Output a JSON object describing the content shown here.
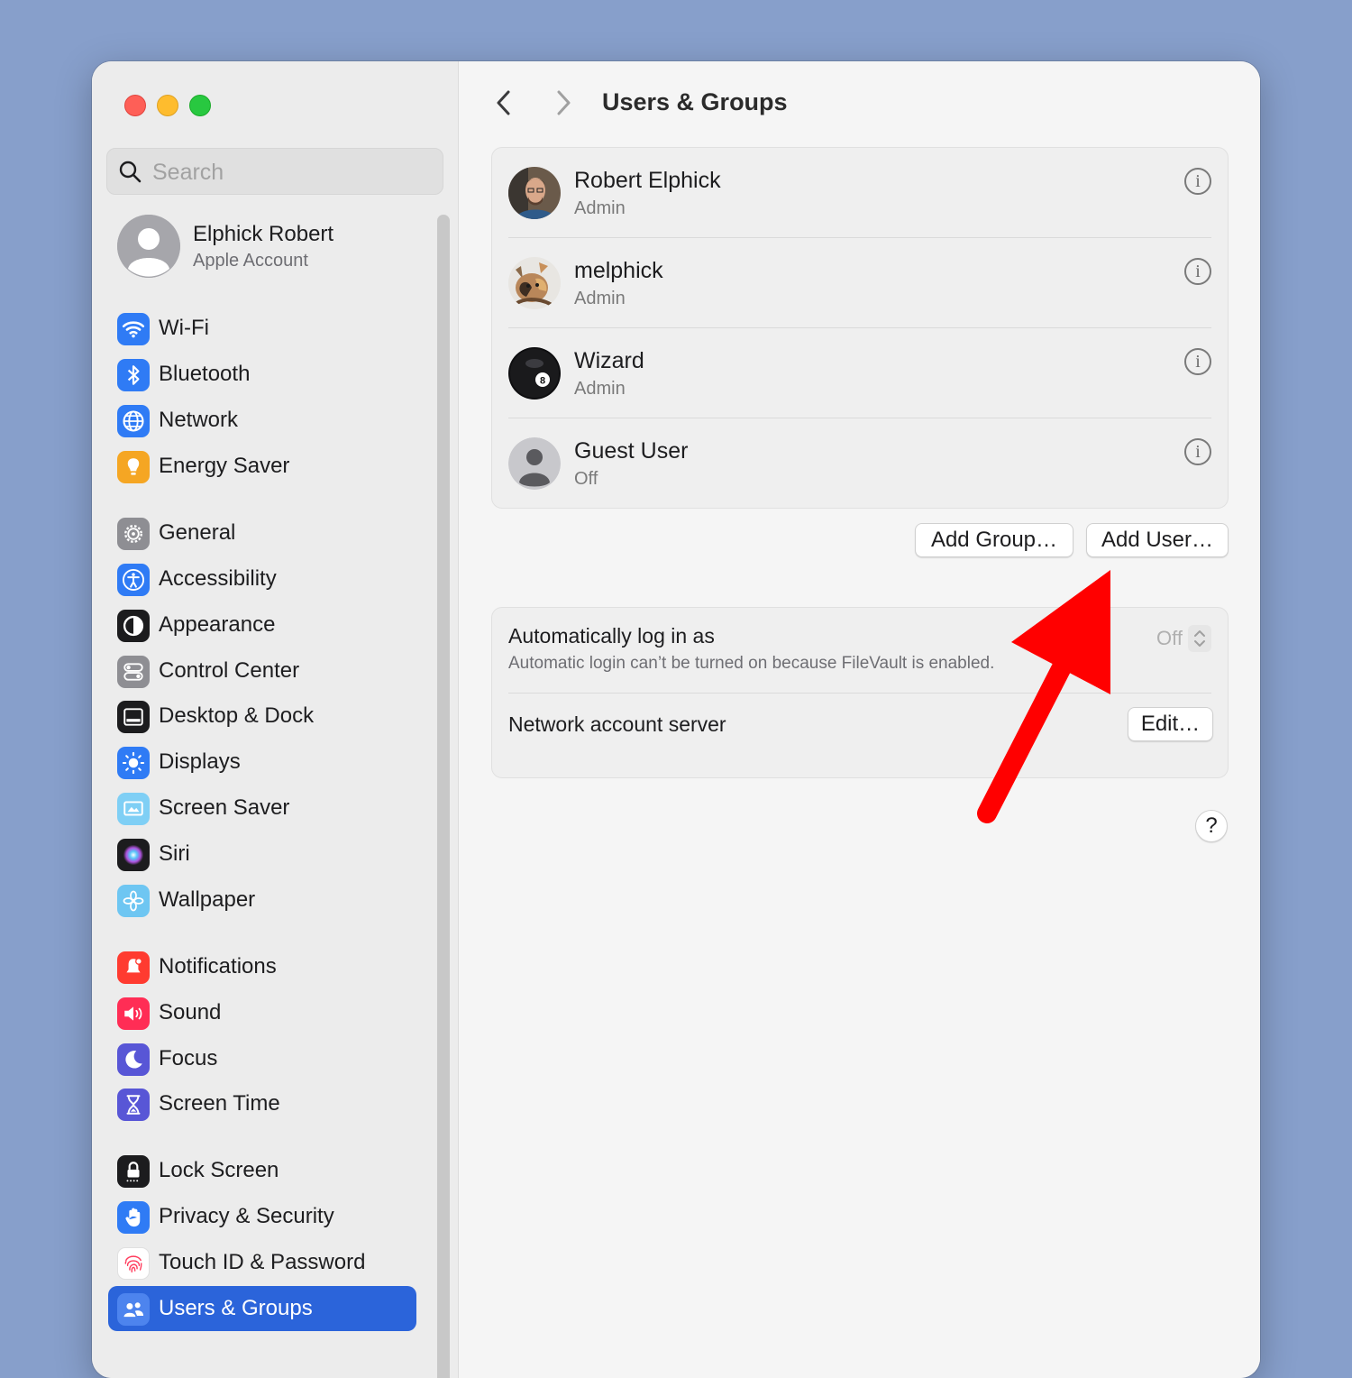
{
  "window": {
    "traffic_lights": [
      "close",
      "minimize",
      "zoom"
    ]
  },
  "search": {
    "placeholder": "Search",
    "value": ""
  },
  "account": {
    "name": "Elphick Robert",
    "subtitle": "Apple Account"
  },
  "sidebar": {
    "items": [
      {
        "label": "Wi-Fi",
        "icon": "wifi-icon",
        "color": "#2f7bf5"
      },
      {
        "label": "Bluetooth",
        "icon": "bluetooth-icon",
        "color": "#2f7bf5"
      },
      {
        "label": "Network",
        "icon": "globe-icon",
        "color": "#2f7bf5"
      },
      {
        "label": "Energy Saver",
        "icon": "lightbulb-icon",
        "color": "#f5a623"
      },
      {
        "label": "General",
        "icon": "gear-icon",
        "color": "#8e8e93"
      },
      {
        "label": "Accessibility",
        "icon": "accessibility-icon",
        "color": "#2f7bf5"
      },
      {
        "label": "Appearance",
        "icon": "appearance-icon",
        "color": "#1c1c1e"
      },
      {
        "label": "Control Center",
        "icon": "toggles-icon",
        "color": "#8e8e93"
      },
      {
        "label": "Desktop & Dock",
        "icon": "dock-icon",
        "color": "#1c1c1e"
      },
      {
        "label": "Displays",
        "icon": "sun-icon",
        "color": "#2f7bf5"
      },
      {
        "label": "Screen Saver",
        "icon": "screensaver-icon",
        "color": "#5ac8fa"
      },
      {
        "label": "Siri",
        "icon": "siri-icon",
        "color": "#1c1c1e"
      },
      {
        "label": "Wallpaper",
        "icon": "flower-icon",
        "color": "#5ac8fa"
      },
      {
        "label": "Notifications",
        "icon": "bell-icon",
        "color": "#ff3b30"
      },
      {
        "label": "Sound",
        "icon": "speaker-icon",
        "color": "#ff2d55"
      },
      {
        "label": "Focus",
        "icon": "moon-icon",
        "color": "#5856d6"
      },
      {
        "label": "Screen Time",
        "icon": "hourglass-icon",
        "color": "#5856d6"
      },
      {
        "label": "Lock Screen",
        "icon": "lock-icon",
        "color": "#1c1c1e"
      },
      {
        "label": "Privacy & Security",
        "icon": "hand-icon",
        "color": "#2f7bf5"
      },
      {
        "label": "Touch ID & Password",
        "icon": "fingerprint-icon",
        "color": "#ffffff"
      },
      {
        "label": "Users & Groups",
        "icon": "users-icon",
        "color": "#2f7bf5",
        "selected": true
      }
    ]
  },
  "header": {
    "title": "Users & Groups"
  },
  "users": [
    {
      "name": "Robert Elphick",
      "role": "Admin",
      "avatar": "photo-portrait"
    },
    {
      "name": "melphick",
      "role": "Admin",
      "avatar": "photo-cat"
    },
    {
      "name": "Wizard",
      "role": "Admin",
      "avatar": "eight-ball"
    },
    {
      "name": "Guest User",
      "role": "Off",
      "avatar": "generic-person"
    }
  ],
  "buttons": {
    "add_group": "Add Group…",
    "add_user": "Add User…",
    "edit": "Edit…",
    "help": "?"
  },
  "auto_login": {
    "title": "Automatically log in as",
    "subtitle": "Automatic login can’t be turned on because FileVault is enabled.",
    "value": "Off"
  },
  "network_server": {
    "title": "Network account server"
  },
  "annotation": {
    "arrow_color": "#ff0000"
  },
  "colors": {
    "accent": "#2b64da",
    "desktop": "#879fcb"
  }
}
